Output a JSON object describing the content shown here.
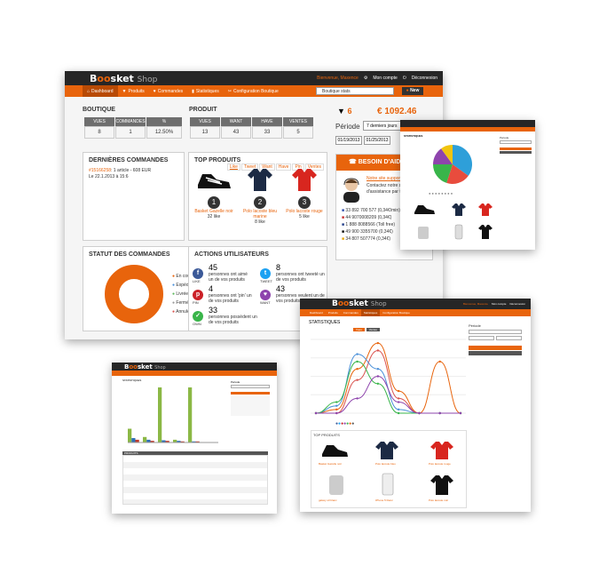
{
  "brand": {
    "logo_b": "B",
    "logo_o": "oo",
    "logo_rest": "sket",
    "logo_shop": "Shop"
  },
  "top": {
    "welcome": "Bienvenue, Maxence",
    "account": "Mon compte",
    "logout": "Déconnexion"
  },
  "nav": {
    "dashboard": "Dashboard",
    "products": "Produits",
    "orders": "Commandes",
    "stats": "Statistiques",
    "config": "Configuration Boutique"
  },
  "select_value": "Boutique stats",
  "new_button": "New",
  "boutique": {
    "title": "BOUTIQUE",
    "stats": [
      {
        "label": "VUES",
        "value": "8"
      },
      {
        "label": "COMMANDES",
        "value": "1"
      },
      {
        "label": "%",
        "value": "12.50%"
      }
    ]
  },
  "produit": {
    "title": "PRODUIT",
    "stats": [
      {
        "label": "VUES",
        "value": "13"
      },
      {
        "label": "WANT",
        "value": "43"
      },
      {
        "label": "HAVE",
        "value": "33"
      },
      {
        "label": "VENTES",
        "value": "5"
      }
    ]
  },
  "summary": {
    "count": "6",
    "amount": "€ 1092.46"
  },
  "periode": {
    "label": "Période",
    "select": "7 derniers jours",
    "date_from": "01/19/2013",
    "date_to": "01/25/2013"
  },
  "orders": {
    "title": "DERNIÈRES COMMANDES",
    "link": "#15166258",
    "text": ": 1 article - 608 EUR",
    "date": "Le 22.1.2013 à 15:6"
  },
  "top_products": {
    "title": "TOP PRODUITS",
    "tabs": [
      "Like",
      "Tweet",
      "Want",
      "Have",
      "Pin",
      "Ventes"
    ],
    "items": [
      {
        "rank": "1",
        "name": "Basket Gazelle noir",
        "likes": "32 like"
      },
      {
        "rank": "2",
        "name": "Polo lacoste bleu marine",
        "likes": "8 like"
      },
      {
        "rank": "3",
        "name": "Polo lacoste rouge",
        "likes": "5 like"
      }
    ]
  },
  "help": {
    "title": "BESOIN D'AIDE ?",
    "link": "Notre site support",
    "text": "Contactez notre service d'assistance par téléphone",
    "phones": [
      "33 892 700 577 (0,34€/min)",
      "44 9070008209 (0,34€)",
      "1 888 8088566 (Toll free)",
      "49 900 3355700 (0,34€)",
      "34 807 507774 (0,34€)"
    ]
  },
  "order_status": {
    "title": "STATUT DES COMMANDES",
    "legend": [
      "En cours",
      "Expédiée",
      "Livrée",
      "Fermée",
      "Annulée"
    ],
    "colors": [
      "#e8640c",
      "#4a90d9",
      "#5cb85c",
      "#999999",
      "#d9534f"
    ]
  },
  "user_actions": {
    "title": "ACTIONS UTILISATEURS",
    "items": [
      {
        "icon": "LIKE",
        "count": "45",
        "text": "personnes ont aimé un de vos produits"
      },
      {
        "icon": "TWEET",
        "count": "8",
        "text": "personnes ont tweeté un de vos produits"
      },
      {
        "icon": "PIN",
        "count": "4",
        "text": "personnes ont 'pin' un de vos produits"
      },
      {
        "icon": "WANT",
        "count": "43",
        "text": "personnes veulent un de vos produits"
      },
      {
        "icon": "OWN",
        "count": "33",
        "text": "personnes possèdent un de vos produits"
      }
    ]
  },
  "pie_chart": {
    "title": "STATISTIQUES",
    "chart_data": {
      "type": "pie",
      "values": [
        35,
        20,
        20,
        15,
        10
      ],
      "colors": [
        "#2e9fd9",
        "#e84c3d",
        "#39b54a",
        "#8e44ad",
        "#f1c40f"
      ]
    }
  },
  "line_shot": {
    "title": "STATISTIQUES",
    "top_products_title": "TOP PRODUITS",
    "periode": "Période",
    "chart_data": {
      "type": "line",
      "series": [
        {
          "color": "#e8640c",
          "values": [
            0,
            5,
            60,
            95,
            30,
            0,
            70,
            0
          ]
        },
        {
          "color": "#d9534f",
          "values": [
            0,
            0,
            45,
            85,
            20,
            0,
            0,
            0
          ]
        },
        {
          "color": "#4a90d9",
          "values": [
            0,
            10,
            80,
            60,
            5,
            0,
            0,
            0
          ]
        },
        {
          "color": "#39b54a",
          "values": [
            0,
            15,
            70,
            40,
            0,
            0,
            0,
            0
          ]
        },
        {
          "color": "#8e44ad",
          "values": [
            0,
            0,
            20,
            50,
            15,
            0,
            0,
            0
          ]
        }
      ]
    },
    "products": [
      {
        "name": "Basket Gazelle noir",
        "likes": "32 like"
      },
      {
        "name": "Polo lacoste bleu",
        "likes": "8 like"
      },
      {
        "name": "Polo lacoste rouge",
        "likes": "5 like"
      },
      {
        "name": "galaxy s3 blanc",
        "likes": ""
      },
      {
        "name": "iPhone 5 blanc",
        "likes": ""
      },
      {
        "name": "Polo lacoste noir",
        "likes": ""
      }
    ]
  },
  "bar_shot": {
    "title": "STATISTIQUES",
    "table_title": "PRODUITS",
    "chart_data": {
      "type": "bar",
      "series": [
        {
          "color": "#8bb845",
          "values": [
            25,
            10,
            100,
            5,
            100,
            0
          ]
        },
        {
          "color": "#2e6fb5",
          "values": [
            8,
            5,
            4,
            3,
            2,
            0
          ]
        },
        {
          "color": "#c0392b",
          "values": [
            5,
            3,
            3,
            2,
            2,
            0
          ]
        }
      ]
    }
  }
}
